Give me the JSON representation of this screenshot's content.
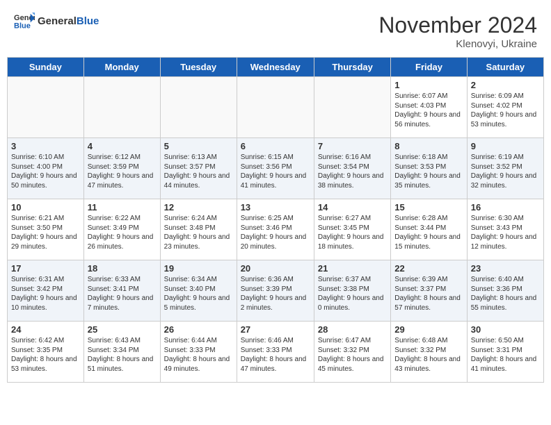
{
  "logo": {
    "text_general": "General",
    "text_blue": "Blue"
  },
  "header": {
    "month_title": "November 2024",
    "subtitle": "Klenovyi, Ukraine"
  },
  "day_headers": [
    "Sunday",
    "Monday",
    "Tuesday",
    "Wednesday",
    "Thursday",
    "Friday",
    "Saturday"
  ],
  "weeks": [
    {
      "alt": false,
      "days": [
        {
          "num": "",
          "info": ""
        },
        {
          "num": "",
          "info": ""
        },
        {
          "num": "",
          "info": ""
        },
        {
          "num": "",
          "info": ""
        },
        {
          "num": "",
          "info": ""
        },
        {
          "num": "1",
          "info": "Sunrise: 6:07 AM\nSunset: 4:03 PM\nDaylight: 9 hours and 56 minutes."
        },
        {
          "num": "2",
          "info": "Sunrise: 6:09 AM\nSunset: 4:02 PM\nDaylight: 9 hours and 53 minutes."
        }
      ]
    },
    {
      "alt": true,
      "days": [
        {
          "num": "3",
          "info": "Sunrise: 6:10 AM\nSunset: 4:00 PM\nDaylight: 9 hours and 50 minutes."
        },
        {
          "num": "4",
          "info": "Sunrise: 6:12 AM\nSunset: 3:59 PM\nDaylight: 9 hours and 47 minutes."
        },
        {
          "num": "5",
          "info": "Sunrise: 6:13 AM\nSunset: 3:57 PM\nDaylight: 9 hours and 44 minutes."
        },
        {
          "num": "6",
          "info": "Sunrise: 6:15 AM\nSunset: 3:56 PM\nDaylight: 9 hours and 41 minutes."
        },
        {
          "num": "7",
          "info": "Sunrise: 6:16 AM\nSunset: 3:54 PM\nDaylight: 9 hours and 38 minutes."
        },
        {
          "num": "8",
          "info": "Sunrise: 6:18 AM\nSunset: 3:53 PM\nDaylight: 9 hours and 35 minutes."
        },
        {
          "num": "9",
          "info": "Sunrise: 6:19 AM\nSunset: 3:52 PM\nDaylight: 9 hours and 32 minutes."
        }
      ]
    },
    {
      "alt": false,
      "days": [
        {
          "num": "10",
          "info": "Sunrise: 6:21 AM\nSunset: 3:50 PM\nDaylight: 9 hours and 29 minutes."
        },
        {
          "num": "11",
          "info": "Sunrise: 6:22 AM\nSunset: 3:49 PM\nDaylight: 9 hours and 26 minutes."
        },
        {
          "num": "12",
          "info": "Sunrise: 6:24 AM\nSunset: 3:48 PM\nDaylight: 9 hours and 23 minutes."
        },
        {
          "num": "13",
          "info": "Sunrise: 6:25 AM\nSunset: 3:46 PM\nDaylight: 9 hours and 20 minutes."
        },
        {
          "num": "14",
          "info": "Sunrise: 6:27 AM\nSunset: 3:45 PM\nDaylight: 9 hours and 18 minutes."
        },
        {
          "num": "15",
          "info": "Sunrise: 6:28 AM\nSunset: 3:44 PM\nDaylight: 9 hours and 15 minutes."
        },
        {
          "num": "16",
          "info": "Sunrise: 6:30 AM\nSunset: 3:43 PM\nDaylight: 9 hours and 12 minutes."
        }
      ]
    },
    {
      "alt": true,
      "days": [
        {
          "num": "17",
          "info": "Sunrise: 6:31 AM\nSunset: 3:42 PM\nDaylight: 9 hours and 10 minutes."
        },
        {
          "num": "18",
          "info": "Sunrise: 6:33 AM\nSunset: 3:41 PM\nDaylight: 9 hours and 7 minutes."
        },
        {
          "num": "19",
          "info": "Sunrise: 6:34 AM\nSunset: 3:40 PM\nDaylight: 9 hours and 5 minutes."
        },
        {
          "num": "20",
          "info": "Sunrise: 6:36 AM\nSunset: 3:39 PM\nDaylight: 9 hours and 2 minutes."
        },
        {
          "num": "21",
          "info": "Sunrise: 6:37 AM\nSunset: 3:38 PM\nDaylight: 9 hours and 0 minutes."
        },
        {
          "num": "22",
          "info": "Sunrise: 6:39 AM\nSunset: 3:37 PM\nDaylight: 8 hours and 57 minutes."
        },
        {
          "num": "23",
          "info": "Sunrise: 6:40 AM\nSunset: 3:36 PM\nDaylight: 8 hours and 55 minutes."
        }
      ]
    },
    {
      "alt": false,
      "days": [
        {
          "num": "24",
          "info": "Sunrise: 6:42 AM\nSunset: 3:35 PM\nDaylight: 8 hours and 53 minutes."
        },
        {
          "num": "25",
          "info": "Sunrise: 6:43 AM\nSunset: 3:34 PM\nDaylight: 8 hours and 51 minutes."
        },
        {
          "num": "26",
          "info": "Sunrise: 6:44 AM\nSunset: 3:33 PM\nDaylight: 8 hours and 49 minutes."
        },
        {
          "num": "27",
          "info": "Sunrise: 6:46 AM\nSunset: 3:33 PM\nDaylight: 8 hours and 47 minutes."
        },
        {
          "num": "28",
          "info": "Sunrise: 6:47 AM\nSunset: 3:32 PM\nDaylight: 8 hours and 45 minutes."
        },
        {
          "num": "29",
          "info": "Sunrise: 6:48 AM\nSunset: 3:32 PM\nDaylight: 8 hours and 43 minutes."
        },
        {
          "num": "30",
          "info": "Sunrise: 6:50 AM\nSunset: 3:31 PM\nDaylight: 8 hours and 41 minutes."
        }
      ]
    }
  ]
}
